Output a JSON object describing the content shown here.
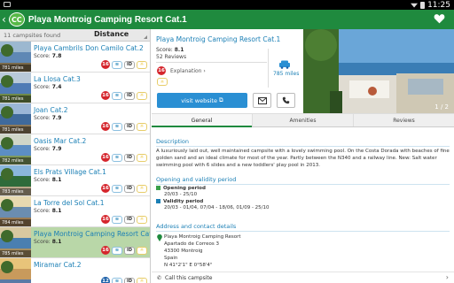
{
  "status": {
    "time": "11:25"
  },
  "appbar": {
    "logo_text": "CC",
    "title": "Playa Montroig Camping Resort Cat.1"
  },
  "list": {
    "count_text": "11 campsites found",
    "sort_label": "Distance",
    "items": [
      {
        "name": "Playa Cambrils Don Camilo Cat.2",
        "score": "7.8",
        "dist": "781 miles",
        "b1": "16",
        "b1_color": "red"
      },
      {
        "name": "La Llosa Cat.3",
        "score": "7.4",
        "dist": "781 miles",
        "b1": "16",
        "b1_color": "red"
      },
      {
        "name": "Joan Cat.2",
        "score": "7.9",
        "dist": "781 miles",
        "b1": "16",
        "b1_color": "red"
      },
      {
        "name": "Oasis Mar Cat.2",
        "score": "7.9",
        "dist": "782 miles",
        "b1": "16",
        "b1_color": "red"
      },
      {
        "name": "Els Prats Village Cat.1",
        "score": "8.1",
        "dist": "783 miles",
        "b1": "16",
        "b1_color": "red"
      },
      {
        "name": "La Torre del Sol Cat.1",
        "score": "8.1",
        "dist": "784 miles",
        "b1": "16",
        "b1_color": "red"
      },
      {
        "name": "Playa Montroig Camping Resort Cat.1",
        "score": "8.1",
        "dist": "785 miles",
        "b1": "16",
        "b1_color": "red"
      },
      {
        "name": "Miramar Cat.2",
        "score": "",
        "dist": "",
        "b1": "12",
        "b1_color": "blue"
      }
    ],
    "score_label": "Score:"
  },
  "detail": {
    "title": "Playa Montroig Camping Resort Cat.1",
    "score_label": "Score:",
    "score": "8.1",
    "reviews": "52 Reviews",
    "badge": "16",
    "explanation": "Explanation",
    "distance": "785 miles",
    "website_button": "visit website",
    "photo_pager": "1 / 2"
  },
  "tabs": [
    "General",
    "Amenities",
    "Reviews"
  ],
  "general": {
    "description_title": "Description",
    "description": "A luxuriously laid out, well maintained campsite with a lovely swimming pool. On the Costa Dorada with beaches of fine golden sand and an ideal climate for most of the year. Partly between the N340 and a railway line. New: Salt water swimming pool with 6 slides and a new toddlers' play pool in 2013.",
    "period_title": "Opening and validity period",
    "opening_label": "Opening period",
    "opening_value": "20/03 - 25/10",
    "validity_label": "Validity period",
    "validity_value": "20/03 - 01/04, 07/04 - 18/06, 01/09 - 25/10",
    "address_title": "Address and contact details",
    "address_lines": [
      "Playa Montroig Camping Resort",
      "Apartado de Correos 3",
      "43300 Montroig",
      "Spain",
      "N 41°2'1\" E 0°58'4\""
    ],
    "call": "Call this campsite"
  },
  "colors": {
    "brand": "#1f8a3e",
    "link": "#1a7fb5",
    "accent": "#2a8fd3",
    "badge_red": "#d5262d"
  }
}
